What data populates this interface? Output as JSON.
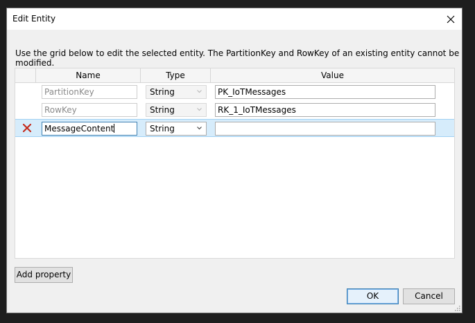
{
  "dialog": {
    "title": "Edit Entity",
    "close_icon": "close-icon",
    "instructions": "Use the grid below to edit the selected entity. The PartitionKey and RowKey of an existing entity cannot be modified."
  },
  "grid": {
    "columns": [
      "Name",
      "Type",
      "Value"
    ],
    "rows": [
      {
        "name": "PartitionKey",
        "type": "String",
        "value": "PK_IoTMessages",
        "editable": false
      },
      {
        "name": "RowKey",
        "type": "String",
        "value": "RK_1_IoTMessages",
        "editable": false
      },
      {
        "name": "MessageContent",
        "type": "String",
        "value": "",
        "editable": true,
        "selected": true,
        "delete_icon": "delete-x-icon"
      }
    ]
  },
  "buttons": {
    "add_property": "Add property",
    "ok": "OK",
    "cancel": "Cancel"
  },
  "colors": {
    "delete_icon": "#c42b1c",
    "selected_row": "#d6ecfb",
    "default_button_border": "#3c7fb1"
  }
}
